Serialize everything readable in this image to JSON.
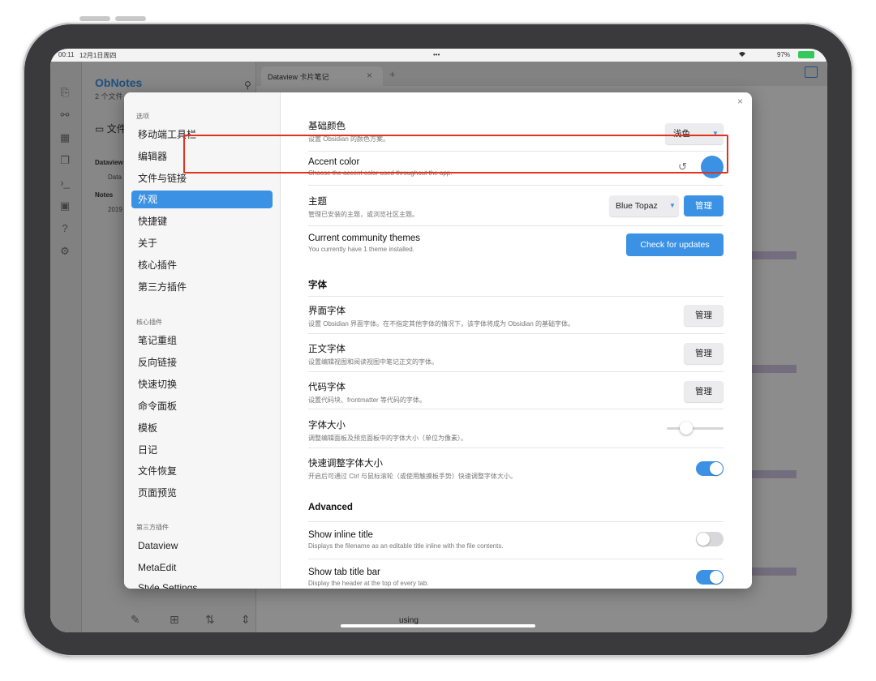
{
  "status_bar": {
    "time": "00:11",
    "date": "12月1日周四",
    "dots": "•••",
    "battery": "97%"
  },
  "background_app": {
    "vault_name": "ObNotes",
    "vault_sub": "2 个文件",
    "folder_label": "文件",
    "tree_items": [
      "Dataview",
      "Data",
      "Notes",
      "2019"
    ],
    "tab_title": "Dataview 卡片笔记",
    "tab_close": "×",
    "tab_add": "+",
    "editor_text": "using"
  },
  "modal": {
    "close": "×",
    "sidebar": {
      "group_options": "选项",
      "options_items": [
        "移动端工具栏",
        "编辑器",
        "文件与链接",
        "外观",
        "快捷键",
        "关于",
        "核心插件",
        "第三方插件"
      ],
      "active_item": "外观",
      "group_core": "核心插件",
      "core_items": [
        "笔记重组",
        "反向链接",
        "快速切换",
        "命令面板",
        "模板",
        "日记",
        "文件恢复",
        "页面预览"
      ],
      "group_community": "第三方插件",
      "community_items": [
        "Dataview",
        "MetaEdit",
        "Style Settings"
      ]
    },
    "settings": {
      "base_color": {
        "title": "基础颜色",
        "desc": "设置 Obsidian 的颜色方案。",
        "value": "浅色"
      },
      "accent_color": {
        "title": "Accent color",
        "desc": "Choose the accent color used throughout the app.",
        "swatch": "#3b92e4"
      },
      "theme": {
        "title": "主题",
        "desc": "管理已安装的主题，或浏览社区主题。",
        "value": "Blue Topaz",
        "button": "管理"
      },
      "community_themes": {
        "title": "Current community themes",
        "desc": "You currently have 1 theme installed.",
        "button": "Check for updates"
      },
      "font_section": "字体",
      "ui_font": {
        "title": "界面字体",
        "desc": "设置 Obsidian 界面字体。在不指定其他字体的情况下，该字体将成为 Obsidian 的基础字体。",
        "button": "管理"
      },
      "text_font": {
        "title": "正文字体",
        "desc": "设置编辑视图和阅读视图中笔记正文的字体。",
        "button": "管理"
      },
      "code_font": {
        "title": "代码字体",
        "desc": "设置代码块、frontmatter 等代码的字体。",
        "button": "管理"
      },
      "font_size": {
        "title": "字体大小",
        "desc": "调整编辑面板及预览面板中的字体大小（单位为像素）。",
        "slider_level": 0.3
      },
      "quick_font_size": {
        "title": "快速调整字体大小",
        "desc": "开启后可通过 Ctrl 与鼠标滚轮（或使用触摸板手势）快速调整字体大小。",
        "enabled": true
      },
      "advanced_section": "Advanced",
      "inline_title": {
        "title": "Show inline title",
        "desc": "Displays the filename as an editable title inline with the file contents.",
        "enabled": false
      },
      "tab_title_bar": {
        "title": "Show tab title bar",
        "desc": "Display the header at the top of every tab.",
        "enabled": true
      }
    }
  },
  "colors": {
    "accent": "#3b92e4",
    "highlight_box": "#e0321e"
  }
}
